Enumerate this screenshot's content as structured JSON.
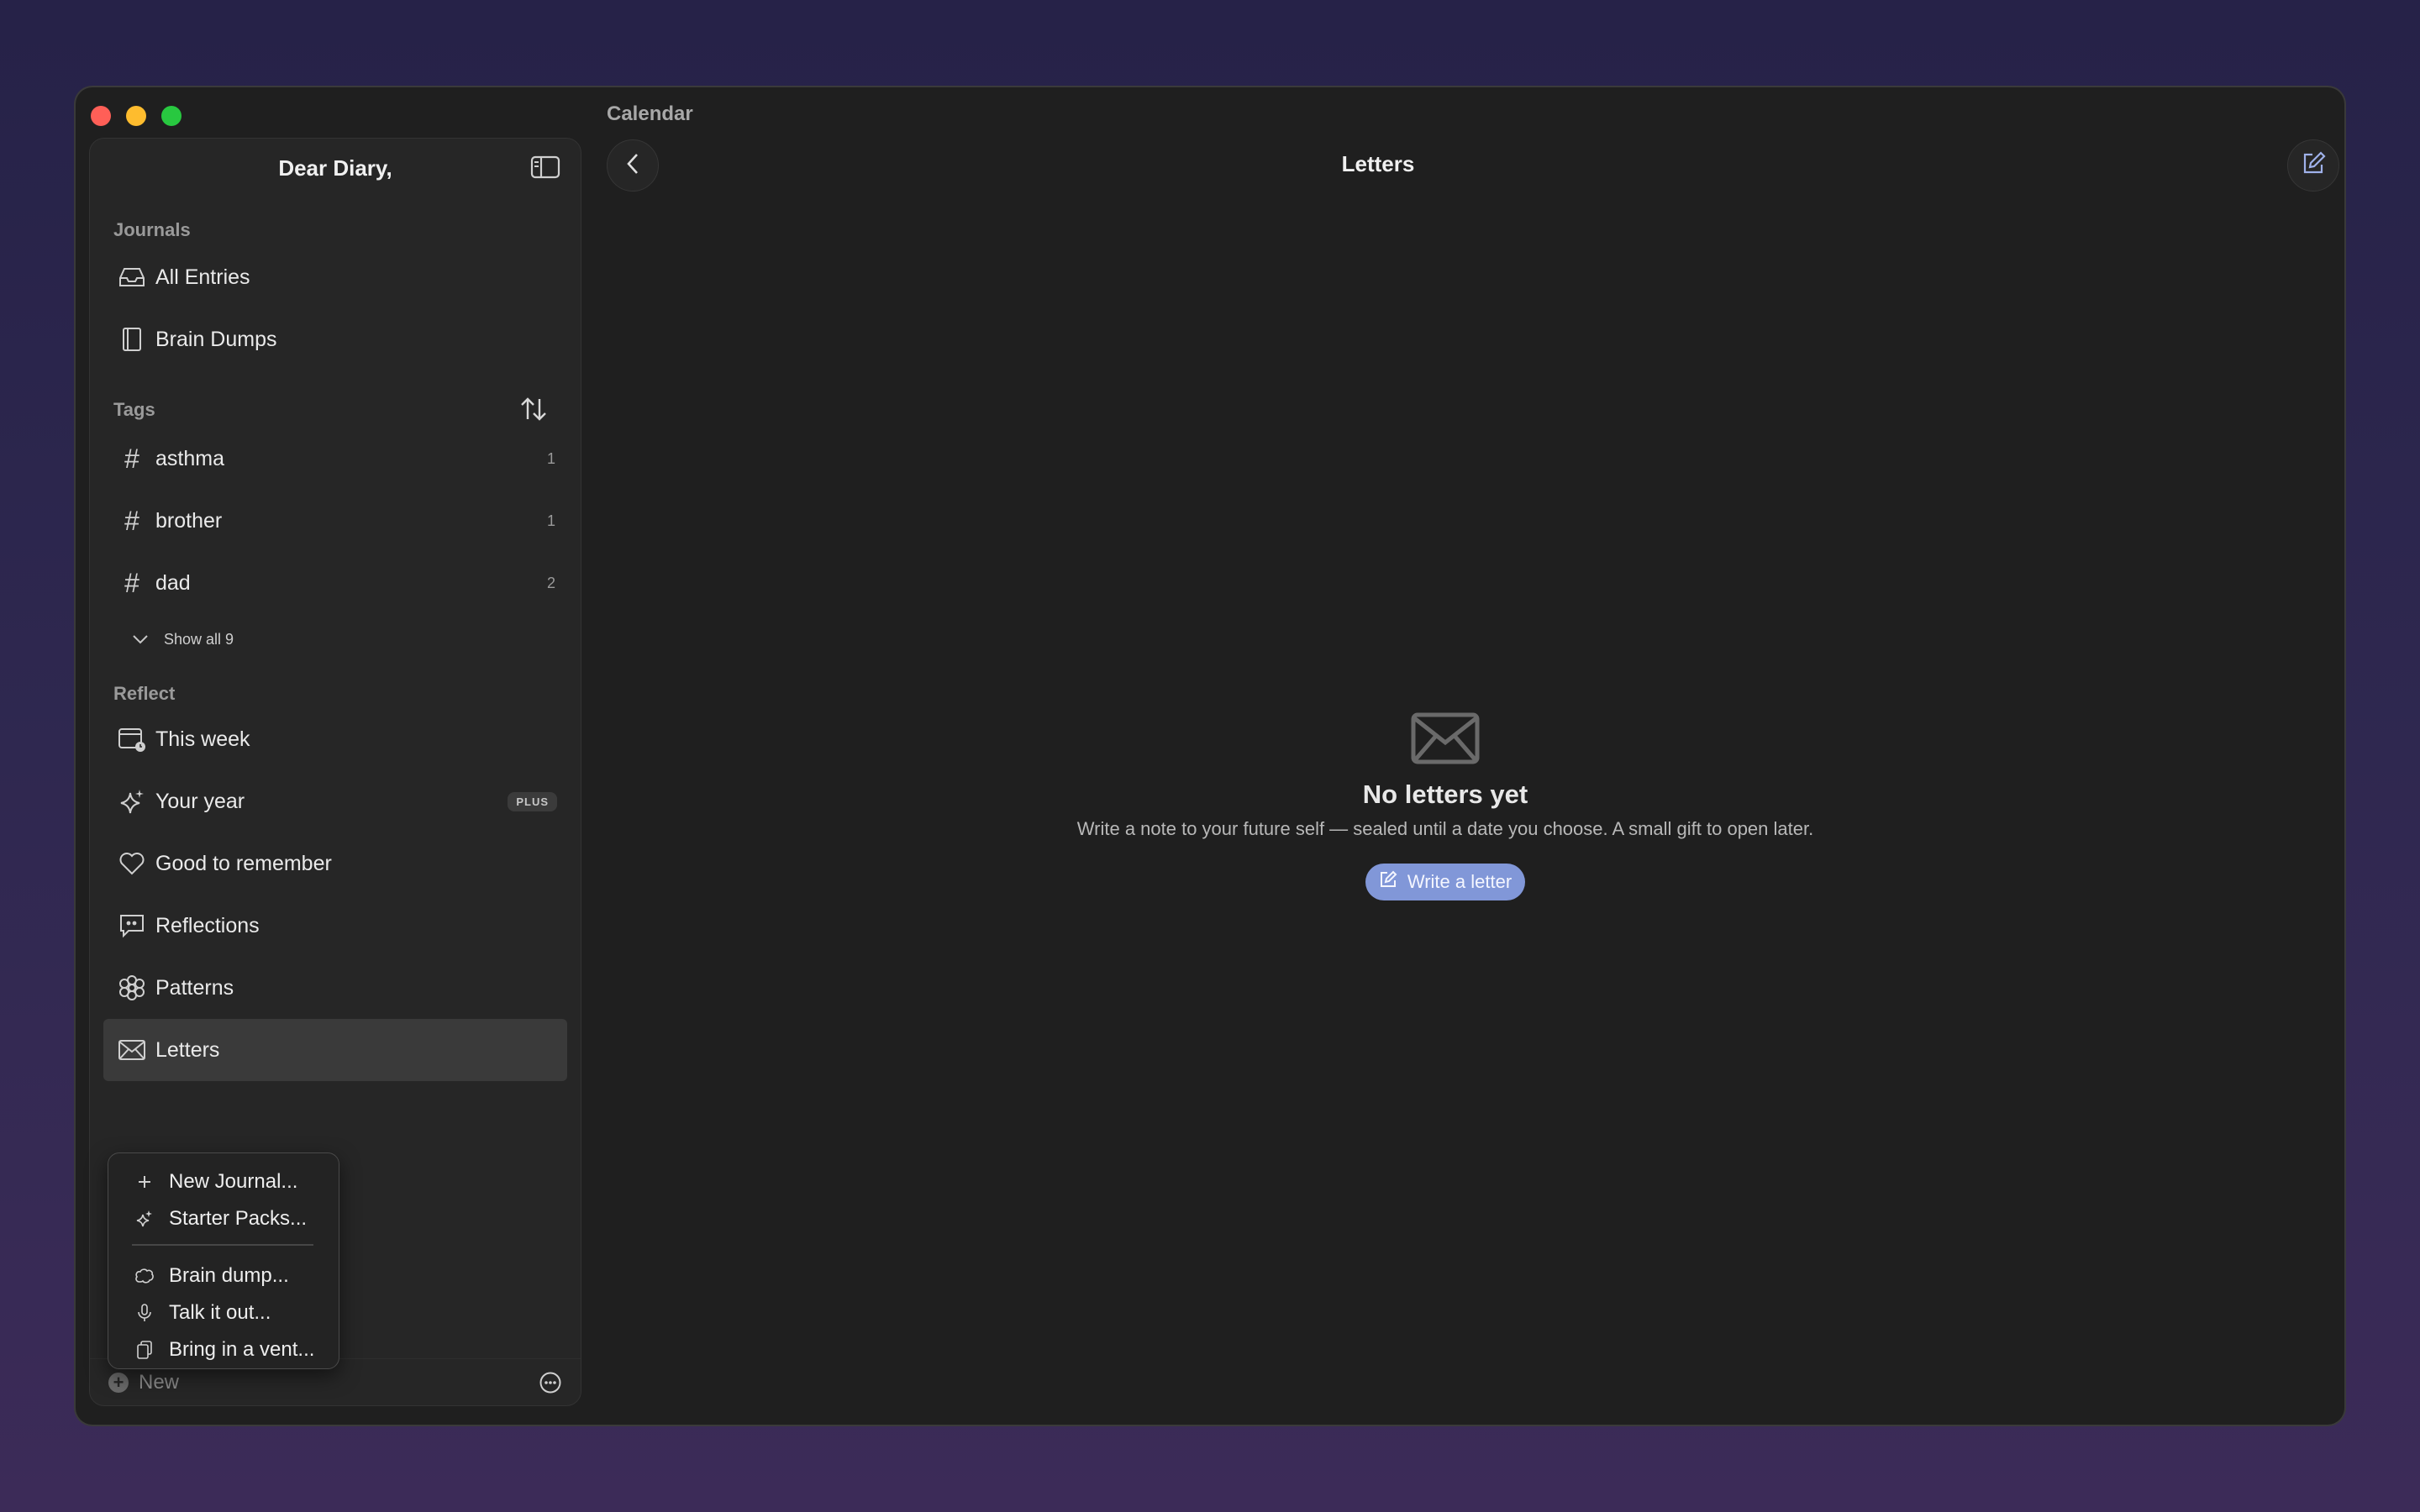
{
  "window": {
    "title": "Calendar"
  },
  "sidebar": {
    "title": "Dear Diary,",
    "journals_label": "Journals",
    "journals": [
      {
        "label": "All Entries",
        "icon": "tray-icon"
      },
      {
        "label": "Brain Dumps",
        "icon": "book-icon"
      }
    ],
    "tags_label": "Tags",
    "tags": [
      {
        "label": "asthma",
        "count": "1"
      },
      {
        "label": "brother",
        "count": "1"
      },
      {
        "label": "dad",
        "count": "2"
      }
    ],
    "show_all": "Show all 9",
    "reflect_label": "Reflect",
    "reflect": [
      {
        "label": "This week",
        "icon": "calendar-icon"
      },
      {
        "label": "Your year",
        "icon": "sparkle-icon",
        "badge": "PLUS"
      },
      {
        "label": "Good to remember",
        "icon": "heart-icon"
      },
      {
        "label": "Reflections",
        "icon": "quote-bubble-icon"
      },
      {
        "label": "Patterns",
        "icon": "flower-icon"
      },
      {
        "label": "Letters",
        "icon": "envelope-icon",
        "active": true
      }
    ],
    "footer": {
      "new_label": "New"
    }
  },
  "popup_menu": {
    "items": [
      {
        "label": "New Journal...",
        "icon": "plus-icon"
      },
      {
        "label": "Starter Packs...",
        "icon": "sparkle-icon"
      },
      {
        "label": "Brain dump...",
        "icon": "brain-icon"
      },
      {
        "label": "Talk it out...",
        "icon": "microphone-icon"
      },
      {
        "label": "Bring in a vent...",
        "icon": "document-icon"
      }
    ]
  },
  "main": {
    "title": "Letters",
    "empty_title": "No letters yet",
    "empty_desc": "Write a note to your future self — sealed until a date you choose. A small gift to open later.",
    "write_button": "Write a letter"
  },
  "colors": {
    "accent": "#8197d8",
    "active_row": "#3a3a3a",
    "background": "#1f1f1f"
  }
}
